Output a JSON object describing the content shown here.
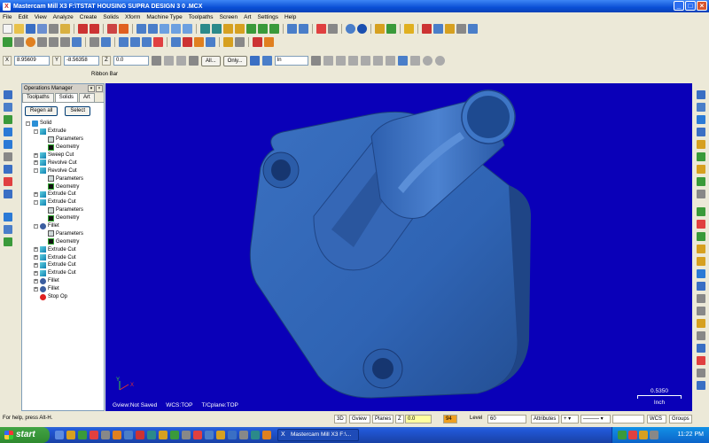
{
  "window": {
    "title": "Mastercam Mill X3  F:\\TSTAT HOUSING SUPRA  DESIGN 3 0 .MCX",
    "app_icon": "X"
  },
  "menu": [
    "File",
    "Edit",
    "View",
    "Analyze",
    "Create",
    "Solids",
    "Xform",
    "Machine Type",
    "Toolpaths",
    "Screen",
    "Art",
    "Settings",
    "Help"
  ],
  "ribbon": {
    "x_label": "X",
    "x_value": "8.95609",
    "y_label": "Y",
    "y_value": "-8.56358",
    "z_label": "Z",
    "z_value": "0.0",
    "all_label": "All...",
    "only_label": "Only...",
    "mode_value": "In",
    "label": "Ribbon Bar"
  },
  "ops_manager": {
    "title": "Operations Manager",
    "tabs": [
      "Toolpaths",
      "Solids",
      "Art"
    ],
    "active_tab": "Solids",
    "regen_label": "Regen all",
    "select_label": "Select",
    "tree": [
      {
        "label": "Solid",
        "level": 0,
        "icon": "solid-icon",
        "exp": "-"
      },
      {
        "label": "Extrude",
        "level": 1,
        "icon": "extrude-icon",
        "exp": "-"
      },
      {
        "label": "Parameters",
        "level": 2,
        "icon": "parameters-icon",
        "exp": ""
      },
      {
        "label": "Geometry",
        "level": 2,
        "icon": "geometry-icon",
        "exp": ""
      },
      {
        "label": "Sweep Cut",
        "level": 1,
        "icon": "sweep-cut-icon",
        "exp": "+"
      },
      {
        "label": "Revolve Cut",
        "level": 1,
        "icon": "revolve-cut-icon",
        "exp": "+"
      },
      {
        "label": "Revolve Cut",
        "level": 1,
        "icon": "revolve-cut-icon",
        "exp": "-"
      },
      {
        "label": "Parameters",
        "level": 2,
        "icon": "parameters-icon",
        "exp": ""
      },
      {
        "label": "Geometry",
        "level": 2,
        "icon": "geometry-icon",
        "exp": ""
      },
      {
        "label": "Extrude Cut",
        "level": 1,
        "icon": "extrude-cut-icon",
        "exp": "+"
      },
      {
        "label": "Extrude Cut",
        "level": 1,
        "icon": "extrude-cut-icon",
        "exp": "-"
      },
      {
        "label": "Parameters",
        "level": 2,
        "icon": "parameters-icon",
        "exp": ""
      },
      {
        "label": "Geometry",
        "level": 2,
        "icon": "geometry-icon",
        "exp": ""
      },
      {
        "label": "Fillet",
        "level": 1,
        "icon": "fillet-icon",
        "exp": "-"
      },
      {
        "label": "Parameters",
        "level": 2,
        "icon": "parameters-icon",
        "exp": ""
      },
      {
        "label": "Geometry",
        "level": 2,
        "icon": "geometry-icon",
        "exp": ""
      },
      {
        "label": "Extrude Cut",
        "level": 1,
        "icon": "extrude-cut-icon",
        "exp": "+"
      },
      {
        "label": "Extrude Cut",
        "level": 1,
        "icon": "extrude-cut-icon",
        "exp": "+"
      },
      {
        "label": "Extrude Cut",
        "level": 1,
        "icon": "extrude-cut-icon",
        "exp": "+"
      },
      {
        "label": "Extrude Cut",
        "level": 1,
        "icon": "extrude-cut-icon",
        "exp": "+"
      },
      {
        "label": "Fillet",
        "level": 1,
        "icon": "fillet-icon",
        "exp": "+"
      },
      {
        "label": "Fillet",
        "level": 1,
        "icon": "fillet-icon",
        "exp": "+"
      },
      {
        "label": "Stop Op",
        "level": 1,
        "icon": "stop-op-icon",
        "exp": ""
      }
    ]
  },
  "viewport": {
    "gview": "Gview:Not Saved",
    "wcs": "WCS:TOP",
    "tplane": "T/Cplane:TOP",
    "scale_value": "0.5350",
    "scale_unit": "Inch",
    "background": "#0a00b8",
    "part_color": "#2f64b4"
  },
  "statusbar": {
    "help": "For help, press Alt-H.",
    "view_3d": "3D",
    "gview": "Gview",
    "planes": "Planes",
    "z_label": "Z",
    "z_value": "0.0",
    "color_value": "94",
    "level_label": "Level",
    "level_value": "60",
    "attributes": "Attributes",
    "wcs": "WCS",
    "groups": "Groups"
  },
  "taskbar": {
    "start": "start",
    "task": "Mastercam Mill X3  F:\\...",
    "clock": "11:22 PM"
  }
}
